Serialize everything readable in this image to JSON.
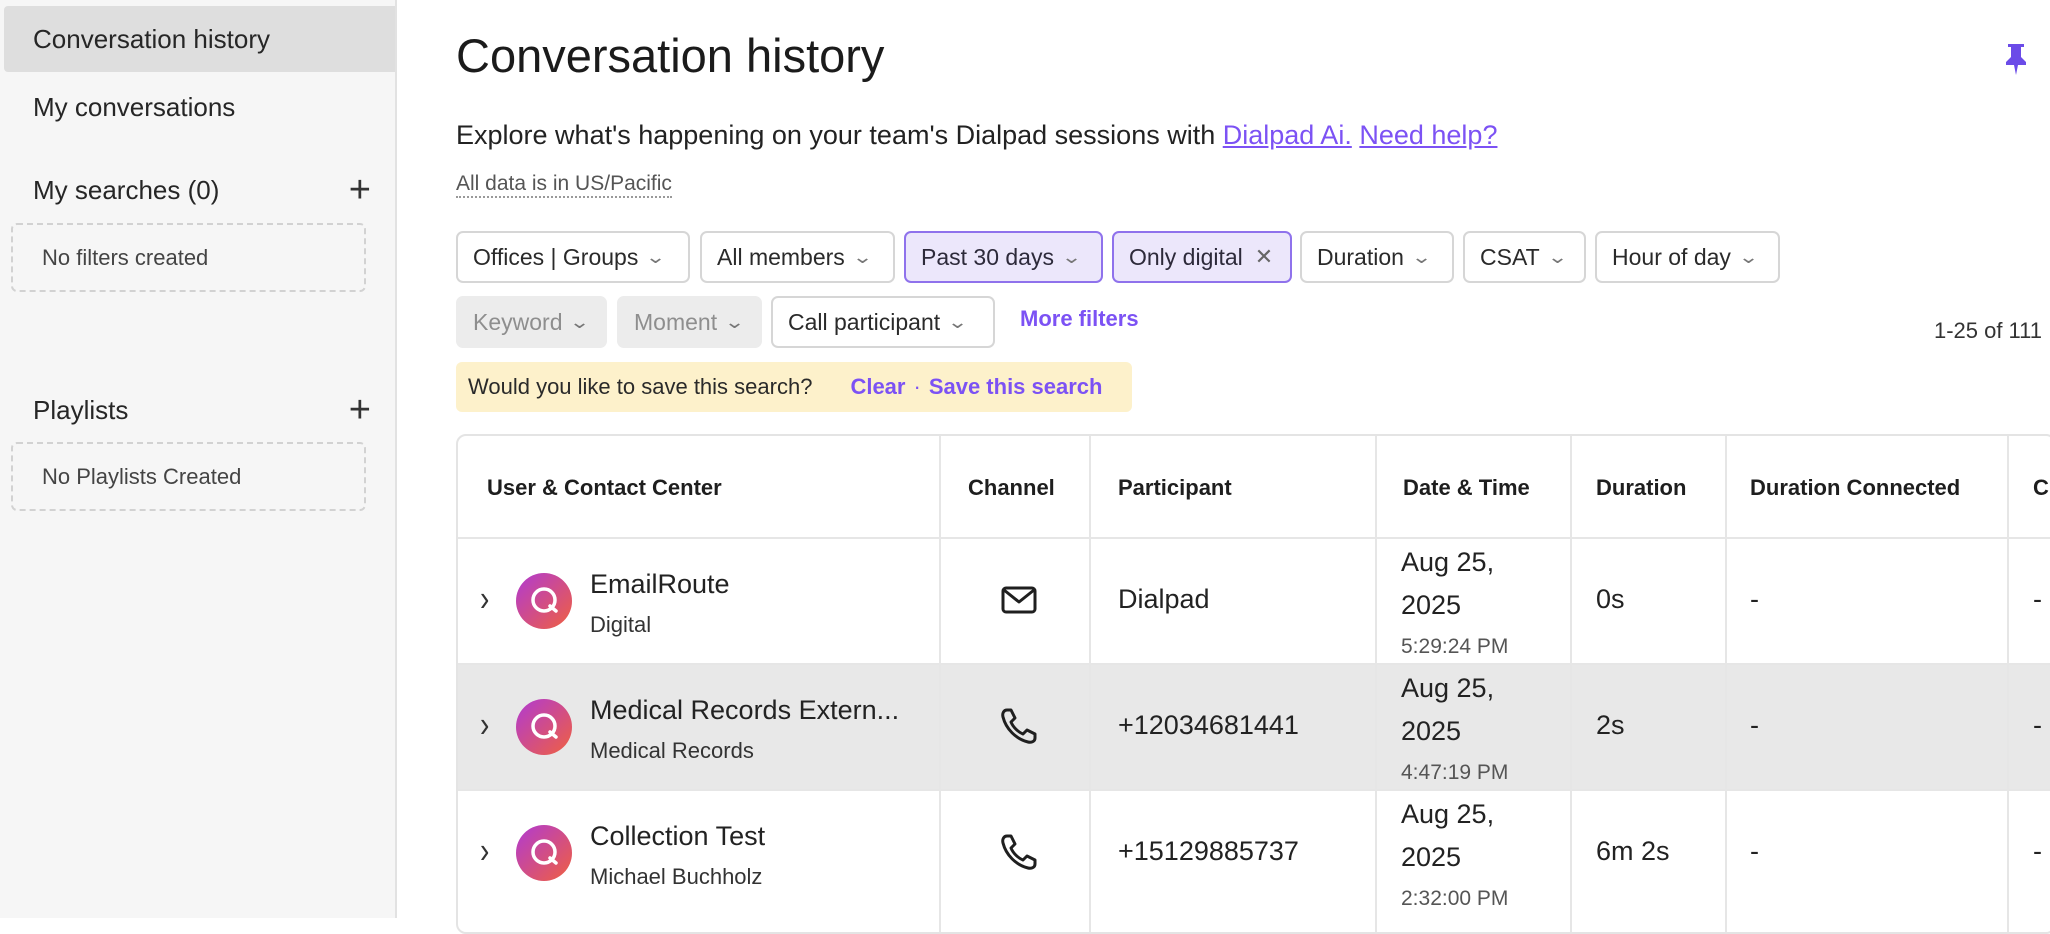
{
  "sidebar": {
    "nav": [
      {
        "label": "Conversation history"
      },
      {
        "label": "My conversations"
      }
    ],
    "searches": {
      "label": "My searches (0)",
      "empty": "No filters created"
    },
    "playlists": {
      "label": "Playlists",
      "empty": "No Playlists Created"
    }
  },
  "page": {
    "title": "Conversation history",
    "intro_text": "Explore what's happening on your team's Dialpad sessions with ",
    "intro_link1": "Dialpad Ai.",
    "intro_link2": "Need help?",
    "timezone": "All data is in US/Pacific"
  },
  "filters": {
    "offices": "Offices | Groups",
    "members": "All members",
    "date": "Past 30 days",
    "digital": "Only digital",
    "duration": "Duration",
    "csat": "CSAT",
    "hour": "Hour of day",
    "keyword": "Keyword",
    "moment": "Moment",
    "participant": "Call participant",
    "more": "More filters"
  },
  "results_count": "1-25 of 111",
  "save_bar": {
    "prompt": "Would you like to save this search?",
    "clear": "Clear",
    "separator": "·",
    "save": "Save this search"
  },
  "table": {
    "headers": [
      "User & Contact Center",
      "Channel",
      "Participant",
      "Date & Time",
      "Duration",
      "Duration Connected",
      "C"
    ],
    "rows": [
      {
        "name": "EmailRoute",
        "sub": "Digital",
        "channel": "mail-icon",
        "participant": "Dialpad",
        "date": "Aug 25,",
        "year": "2025",
        "time": "5:29:24 PM",
        "duration": "0s",
        "connected": "-",
        "extra": "-"
      },
      {
        "name": "Medical Records Extern...",
        "sub": "Medical Records",
        "channel": "phone-icon",
        "participant": "+12034681441",
        "date": "Aug 25,",
        "year": "2025",
        "time": "4:47:19 PM",
        "duration": "2s",
        "connected": "-",
        "extra": "-"
      },
      {
        "name": "Collection Test",
        "sub": "Michael Buchholz",
        "channel": "phone-icon",
        "participant": "+15129885737",
        "date": "Aug 25,",
        "year": "2025",
        "time": "2:32:00 PM",
        "duration": "6m 2s",
        "connected": "-",
        "extra": "-"
      }
    ]
  },
  "colors": {
    "accent": "#7c52f4",
    "selected_chip_bg": "#ece7fb",
    "save_bar_bg": "#fdf1cb",
    "row_highlight": "#e8e8e8"
  }
}
